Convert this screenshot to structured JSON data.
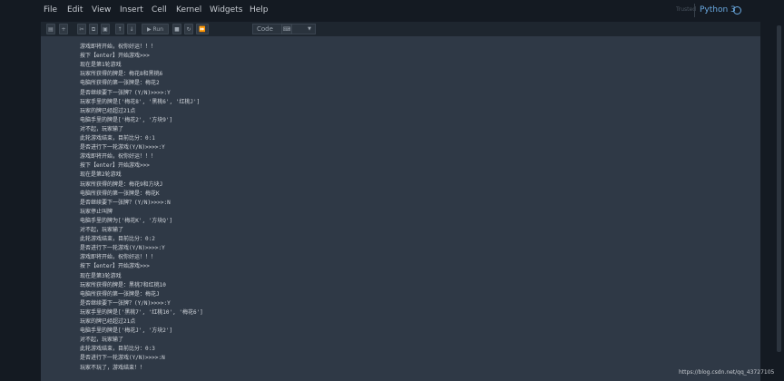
{
  "menu": [
    "File",
    "Edit",
    "View",
    "Insert",
    "Cell",
    "Kernel",
    "Widgets",
    "Help"
  ],
  "status": {
    "trusted": "Trusted",
    "kernel": "Python 3"
  },
  "toolbar": {
    "run_label": "Run",
    "cell_type": "Code",
    "icons": [
      "save-icon",
      "plus-icon",
      "cut-icon",
      "copy-icon",
      "paste-icon",
      "arrow-up-icon",
      "arrow-down-icon",
      "run-icon",
      "stop-icon",
      "restart-icon",
      "fast-forward-icon",
      "keyboard-icon"
    ]
  },
  "output": [
    "游戏即将开始，祝你好运！！！",
    "按下【enter】开始游戏>>>",
    "现在是第1轮游戏",
    "玩家所获得的牌是：梅花8和黑桃6",
    "电脑所获得的第一张牌是：梅花2",
    "是否继续要下一张牌？(Y/N)>>>>:Y",
    "玩家手里的牌是['梅花8', '黑桃6', '红桃J']",
    "玩家的牌已经超过21点",
    "电脑手里的牌是['梅花2', '方块9']",
    "对不起，玩家输了",
    "此轮游戏结束，目前比分：0:1",
    "是否进行下一轮游戏(Y/N)>>>>:Y",
    "游戏即将开始，祝你好运！！！",
    "按下【enter】开始游戏>>>",
    "现在是第2轮游戏",
    "玩家所获得的牌是：梅花9和方块J",
    "电脑所获得的第一张牌是：梅花K",
    "是否继续要下一张牌？(Y/N)>>>>:N",
    "玩家停止叫牌",
    "电脑手里的牌为['梅花K', '方块Q']",
    "对不起，玩家输了",
    "此轮游戏结束，目前比分：0:2",
    "是否进行下一轮游戏(Y/N)>>>>:Y",
    "游戏即将开始，祝你好运！！！",
    "按下【enter】开始游戏>>>",
    "现在是第3轮游戏",
    "玩家所获得的牌是：黑桃7和红桃10",
    "电脑所获得的第一张牌是：梅花J",
    "是否继续要下一张牌？(Y/N)>>>>:Y",
    "玩家手里的牌是['黑桃7', '红桃10', '梅花6']",
    "玩家的牌已经超过21点",
    "电脑手里的牌是['梅花J', '方块2']",
    "对不起，玩家输了",
    "此轮游戏结束，目前比分：0:3",
    "是否进行下一轮游戏(Y/N)>>>>:N",
    "玩家不玩了，游戏结束！！"
  ],
  "watermark": "https://blog.csdn.net/qq_43727105"
}
